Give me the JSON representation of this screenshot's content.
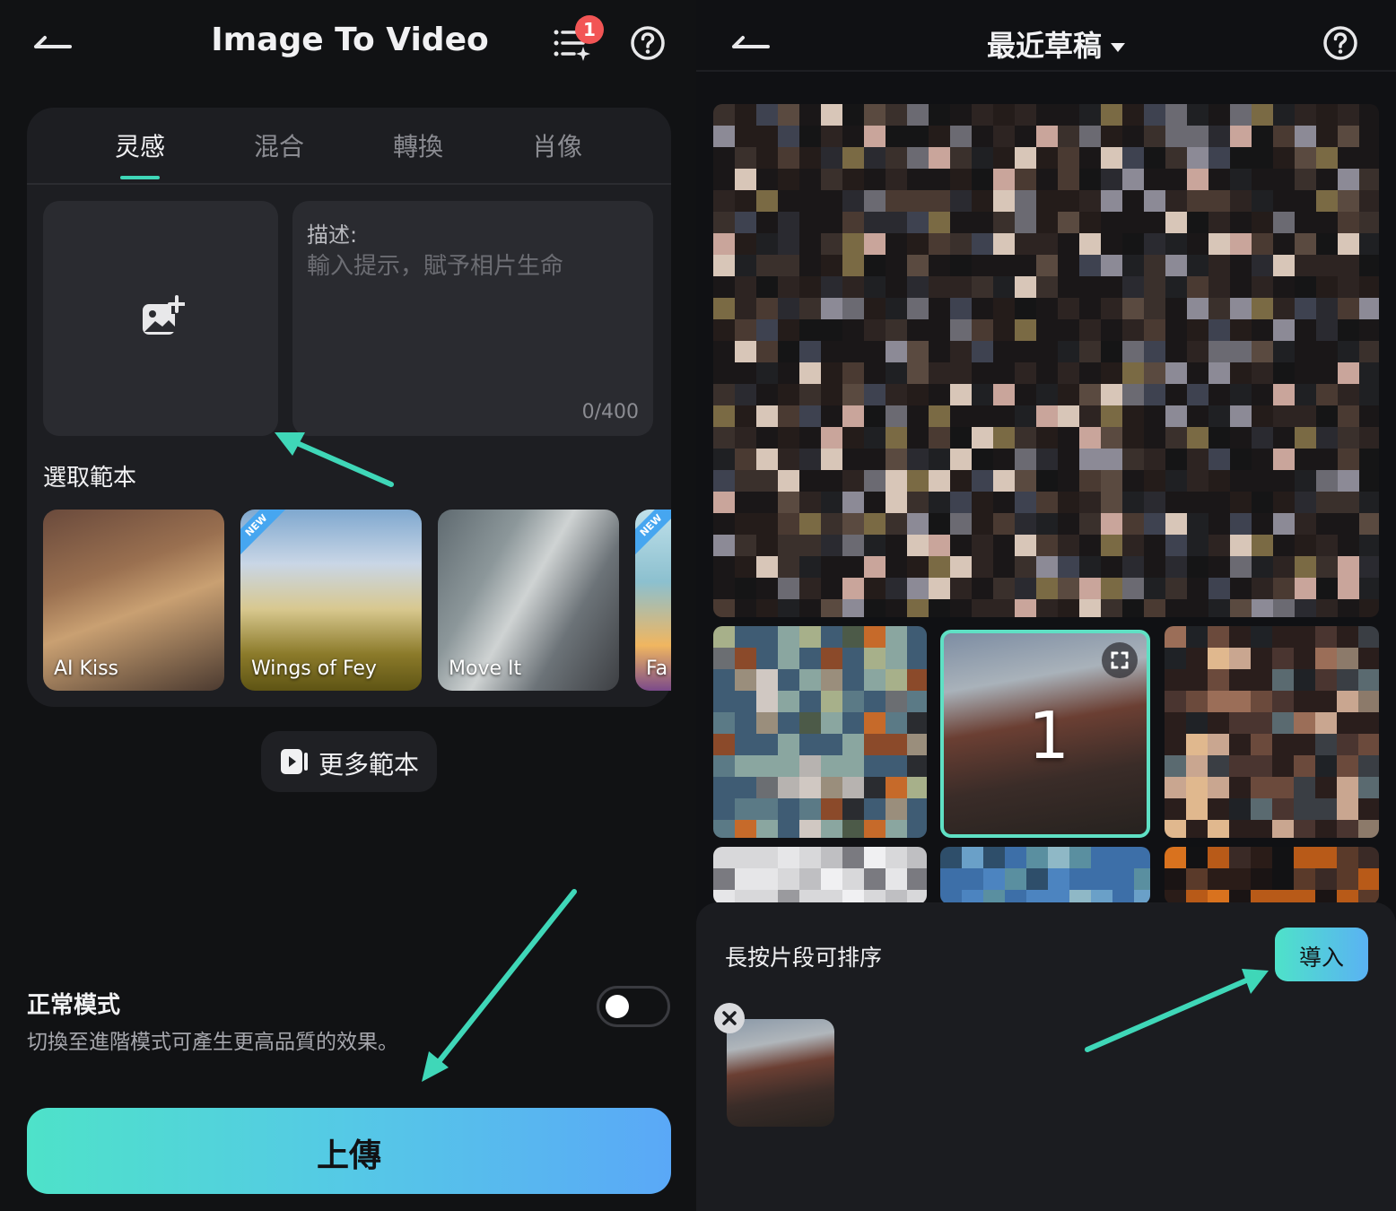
{
  "left": {
    "title": "Image To Video",
    "queue_badge": "1",
    "tabs": [
      {
        "label": "灵感"
      },
      {
        "label": "混合"
      },
      {
        "label": "轉換"
      },
      {
        "label": "肖像"
      }
    ],
    "description": {
      "label": "描述:",
      "placeholder": "輸入提示，賦予相片生命",
      "counter": "0/400"
    },
    "templates_title": "選取範本",
    "templates": [
      {
        "label": "AI Kiss",
        "is_new": false
      },
      {
        "label": "Wings of Fey",
        "is_new": true
      },
      {
        "label": "Move It",
        "is_new": false
      },
      {
        "label": "Fa",
        "is_new": true
      }
    ],
    "new_tag": "NEW",
    "more_templates_label": "更多範本",
    "mode": {
      "title": "正常模式",
      "description": "切換至進階模式可產生更高品質的效果。",
      "advanced_enabled": false
    },
    "upload_label": "上傳"
  },
  "right": {
    "title": "最近草稿",
    "selected_index": "1",
    "sheet_title": "長按片段可排序",
    "import_label": "導入"
  },
  "colors": {
    "accent": "#3fd7b8",
    "badge": "#f25555",
    "gradient_start": "#4ee2c9",
    "gradient_end": "#5aa8f7",
    "annotation_arrow": "#3fd7b8"
  }
}
